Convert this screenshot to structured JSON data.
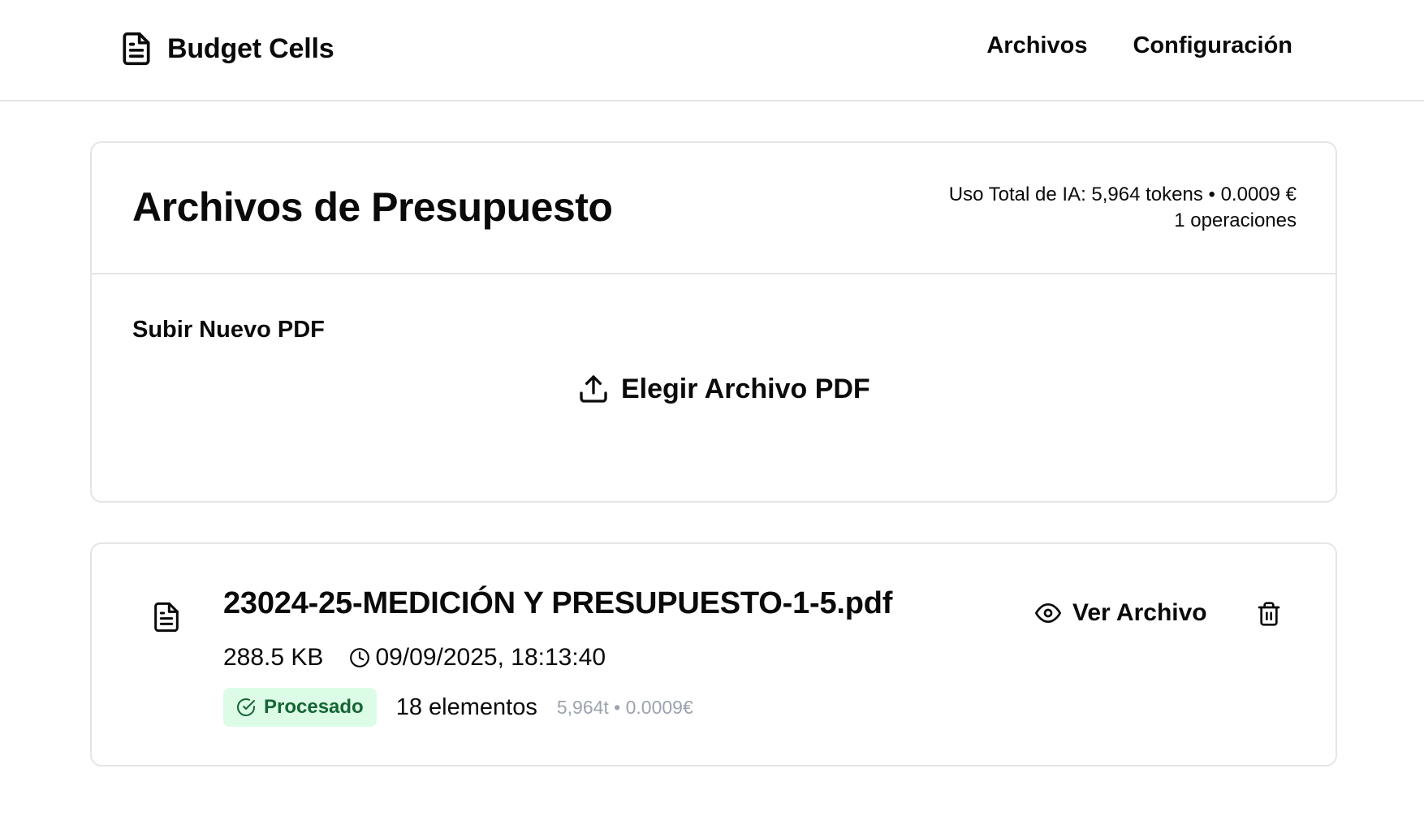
{
  "header": {
    "brand": "Budget Cells",
    "brand_icon": "file-text-icon",
    "nav": [
      "Archivos",
      "Configuración"
    ]
  },
  "main": {
    "title": "Archivos de Presupuesto",
    "usage_line1": "Uso Total de IA: 5,964 tokens • 0.0009 €",
    "usage_line2": "1 operaciones",
    "upload_label": "Subir Nuevo PDF",
    "upload_button": "Elegir Archivo PDF",
    "upload_icon": "upload-icon"
  },
  "files": [
    {
      "name": "23024-25-MEDICIÓN Y PRESUPUESTO-1-5.pdf",
      "size": "288.5 KB",
      "date": "09/09/2025, 18:13:40",
      "status": "Procesado",
      "elements": "18 elementos",
      "cost": "5,964t • 0.0009€",
      "view_label": "Ver Archivo"
    }
  ],
  "colors": {
    "status_bg": "#dcfce7",
    "status_text": "#166534",
    "muted_text": "#9ca3af",
    "border": "#e5e5e5"
  }
}
